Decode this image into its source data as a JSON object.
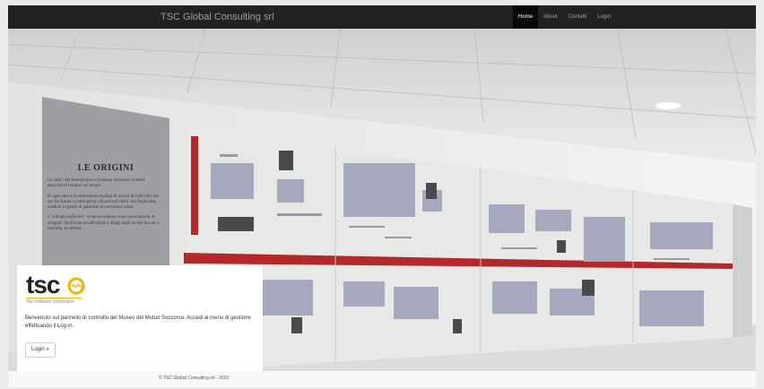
{
  "navbar": {
    "brand": "TSC Global Consulting srl",
    "links": [
      {
        "label": "Home",
        "active": true
      },
      {
        "label": "About",
        "active": false
      },
      {
        "label": "Contatti",
        "active": false
      },
      {
        "label": "Login",
        "active": false
      }
    ]
  },
  "hero": {
    "panel_title": "LE ORIGINI",
    "panel_paragraphs": [
      "Le radici del mutualismo si possono ritrovare in realtà associative lontane nel tempo.",
      "In ogni epoca si intravedono esempi di unioni di individui che per far fronte a contingenze sfavorevoli della vita fondavano sodalizi in grado di garantire un reciproco aiuto.",
      "I \"collegia opificum\" in epoca romana erano associazioni di artigiani finalizzate ad affrontare i disagi degli iscritti dovuti a malattia, invalidità."
    ]
  },
  "card": {
    "logo_text": "tsc",
    "logo_subtitle": "the software connection",
    "message": "Benvenuto sul pannello di controllo del Museo del Mutuo Soccorso. Accedi al menu di gestione effettuando il Log-in.",
    "login_label": "Login »"
  },
  "footer": {
    "text": "© TSC Global Consulting srl - 2019"
  },
  "colors": {
    "navbar_bg": "#222222",
    "accent_red": "#b3282b",
    "logo_accent": "#f0b400"
  }
}
